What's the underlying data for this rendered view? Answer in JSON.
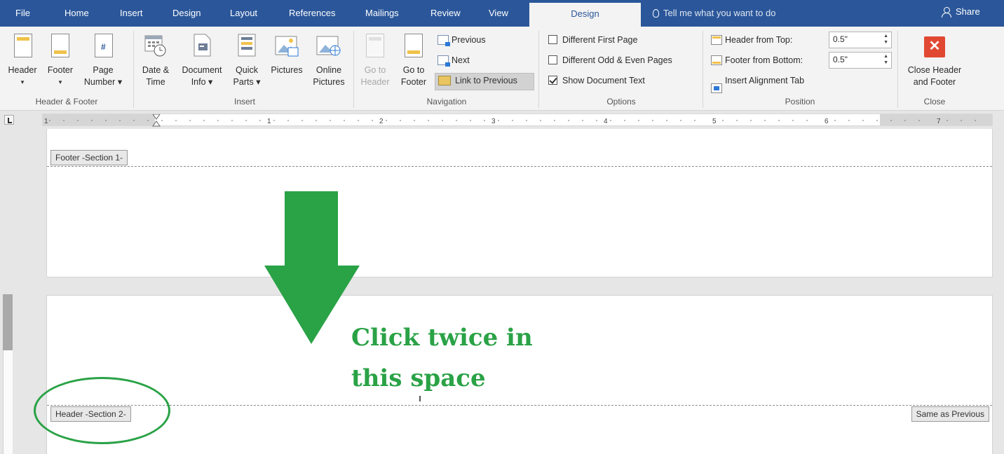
{
  "tabs": [
    "File",
    "Home",
    "Insert",
    "Design",
    "Layout",
    "References",
    "Mailings",
    "Review",
    "View",
    "Design"
  ],
  "tell_me": "Tell me what you want to do",
  "share": "Share",
  "ribbon": {
    "header_footer": {
      "header": "Header",
      "footer": "Footer",
      "page": "Page",
      "number": "Number",
      "group": "Header & Footer"
    },
    "insert": {
      "date": "Date &",
      "time": "Time",
      "document": "Document",
      "info": "Info",
      "quick": "Quick",
      "parts": "Parts",
      "pictures": "Pictures",
      "online": "Online",
      "online2": "Pictures",
      "group": "Insert"
    },
    "navigation": {
      "goto1": "Go to",
      "header": "Header",
      "goto2": "Go to",
      "footer": "Footer",
      "previous": "Previous",
      "next": "Next",
      "link": "Link to Previous",
      "group": "Navigation"
    },
    "options": {
      "first": "Different First Page",
      "odd_even": "Different Odd & Even Pages",
      "show_text": "Show Document Text",
      "group": "Options"
    },
    "position": {
      "header_top": "Header from Top:",
      "header_val": "0.5\"",
      "footer_bottom": "Footer from Bottom:",
      "footer_val": "0.5\"",
      "align_tab": "Insert Alignment Tab",
      "group": "Position"
    },
    "close": {
      "line1": "Close Header",
      "line2": "and Footer",
      "group": "Close"
    }
  },
  "ruler": {
    "numbers": [
      "1",
      "1",
      "2",
      "3",
      "4",
      "5",
      "6",
      "7"
    ]
  },
  "document": {
    "footer_tag": "Footer -Section 1-",
    "header_tag": "Header -Section 2-",
    "same_prev": "Same as Previous",
    "callout1": "Click twice in",
    "callout2": "this space"
  },
  "colors": {
    "tab_bar": "#2b579a",
    "annotation": "#2aa246",
    "close_icon": "#e14832"
  }
}
